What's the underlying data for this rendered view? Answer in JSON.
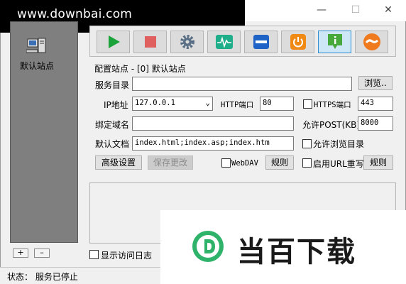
{
  "watermark": {
    "text": "www.downbai.com"
  },
  "window": {
    "minimize": "—",
    "maximize": "☐",
    "close": "✕"
  },
  "sidebar": {
    "sites": [
      {
        "label": "默认站点"
      }
    ],
    "add_label": "+",
    "remove_label": "–"
  },
  "toolbar": {
    "buttons": [
      {
        "name": "start",
        "icon": "play-icon",
        "color": "#1aa33a"
      },
      {
        "name": "stop",
        "icon": "stop-icon",
        "color": "#e05050"
      },
      {
        "name": "settings",
        "icon": "gear-icon",
        "color": "#5a6f86"
      },
      {
        "name": "monitor",
        "icon": "pulse-icon",
        "color": "#1fae8a"
      },
      {
        "name": "window",
        "icon": "window-icon",
        "color": "#1f63c6"
      },
      {
        "name": "power",
        "icon": "power-icon",
        "color": "#f08a14"
      },
      {
        "name": "info",
        "icon": "info-icon",
        "color": "#47a83c",
        "selected": true
      },
      {
        "name": "handshake",
        "icon": "handshake-icon",
        "color": "#f07a1e"
      }
    ]
  },
  "config": {
    "section_title": "配置站点 - [0] 默认站点",
    "service_dir_label": "服务目录",
    "service_dir_value": "",
    "browse_label": "浏览..",
    "ip_label": "IP地址",
    "ip_value": "127.0.0.1",
    "http_port_label": "HTTP端口",
    "http_port_value": "80",
    "https_port_label": "HTTPS端口",
    "https_port_value": "443",
    "https_checked": false,
    "bind_domain_label": "绑定域名",
    "bind_domain_value": "",
    "allow_post_label": "允许POST(KB)",
    "allow_post_value": "8000",
    "default_doc_label": "默认文档",
    "default_doc_value": "index.html;index.asp;index.htm",
    "allow_browse_label": "允许浏览目录",
    "allow_browse_checked": false,
    "advanced_label": "高级设置",
    "save_label": "保存更改",
    "webdav_label": "WebDAV",
    "webdav_checked": false,
    "rules_label": "规则",
    "url_rewrite_label": "启用URL重写",
    "url_rewrite_checked": false,
    "rules2_label": "规则"
  },
  "log": {
    "show_log_label": "显示访问日志",
    "checked": false
  },
  "status": {
    "text": "状态： 服务已停止"
  },
  "brand": {
    "logo_letter": "D",
    "text": "当百下载",
    "color": "#2fb36a"
  }
}
